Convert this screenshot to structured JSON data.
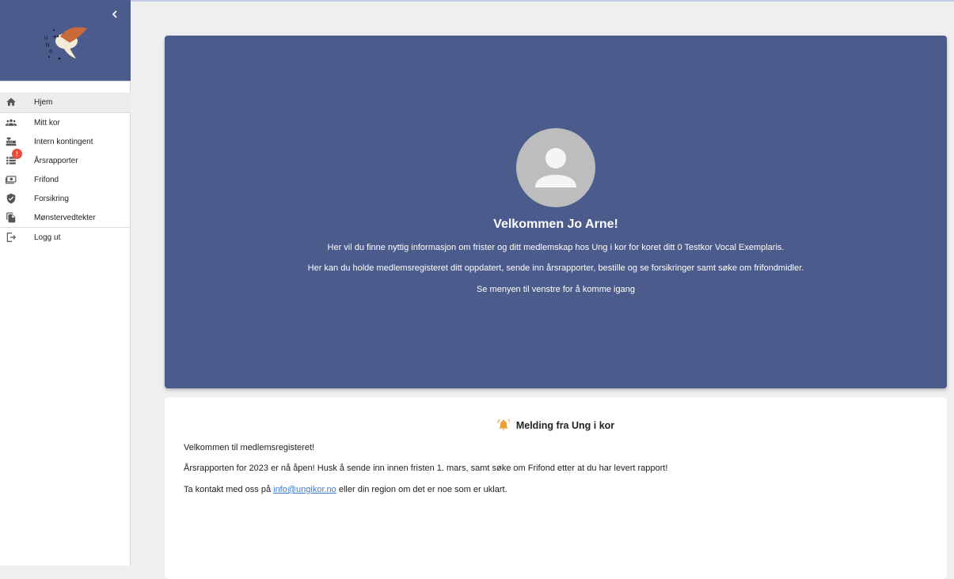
{
  "sidebar": {
    "collapse_icon": "chevron-left-icon",
    "logo": "ung-i-kor-bird-logo",
    "items": [
      {
        "label": "Hjem",
        "icon": "home-icon"
      },
      {
        "label": "Mitt kor",
        "icon": "group-icon"
      },
      {
        "label": "Intern kontingent",
        "icon": "cash-register-icon"
      },
      {
        "label": "Årsrapporter",
        "icon": "list-icon",
        "badge": "!"
      },
      {
        "label": "Frifond",
        "icon": "money-icon"
      },
      {
        "label": "Forsikring",
        "icon": "shield-check-icon"
      },
      {
        "label": "Mønstervedtekter",
        "icon": "documents-icon"
      },
      {
        "label": "Logg ut",
        "icon": "logout-icon"
      }
    ]
  },
  "welcome": {
    "avatar_icon": "person-icon",
    "title": "Velkommen Jo Arne!",
    "line1": "Her vil du finne nyttig informasjon om frister og ditt medlemskap hos Ung i kor for koret ditt 0 Testkor Vocal Exemplaris.",
    "line2": "Her kan du holde medlemsregisteret ditt oppdatert, sende inn årsrapporter, bestille og se forsikringer samt søke om frifondmidler.",
    "line3": "Se menyen til venstre for å komme igang"
  },
  "message": {
    "icon": "bell-icon",
    "title": "Melding fra Ung i kor",
    "line1": "Velkommen til medlemsregisteret!",
    "line2": "Årsrapporten for 2023 er nå åpen! Husk å sende inn innen fristen 1. mars, samt søke om Frifond etter at du har levert rapport!",
    "line3_prefix": "Ta kontakt med oss på",
    "line3_link": "info@ungikor.no",
    "line3_suffix": "eller din region om det er noe som er uklart."
  },
  "colors": {
    "primary": "#4a5b8c",
    "accent": "#f0a030",
    "badge": "#e74c3c",
    "link": "#3a7bd5"
  }
}
